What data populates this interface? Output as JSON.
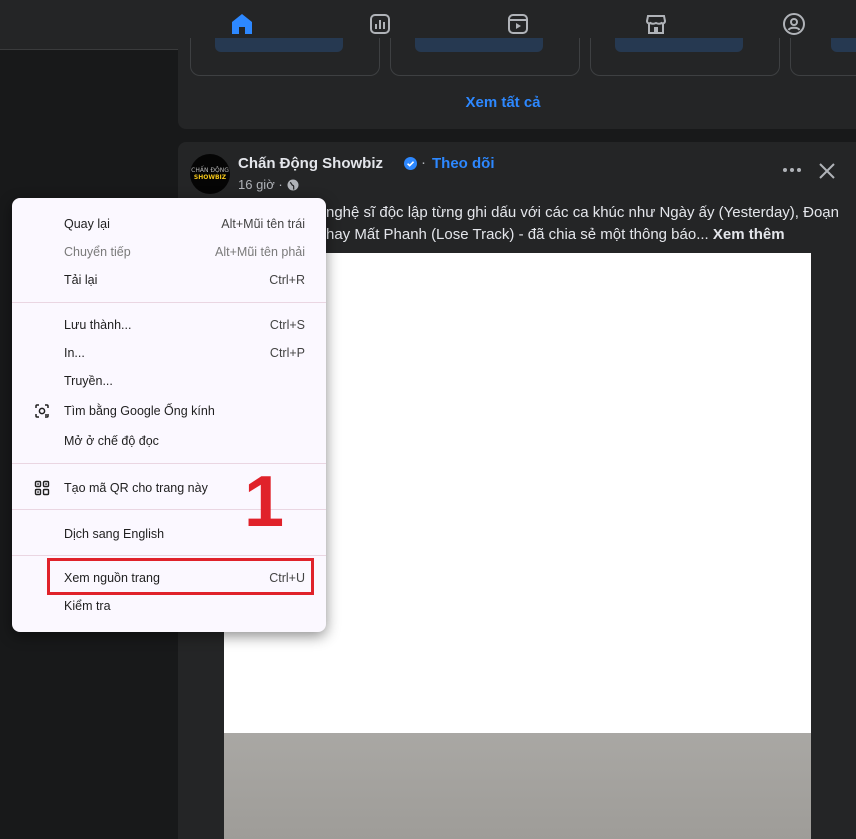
{
  "colors": {
    "accent": "#2d88ff",
    "page_bg": "#18191a",
    "card_bg": "#242526",
    "highlight_red": "#e0222a",
    "menu_bg": "#fbf8ff"
  },
  "topnav": {
    "items": [
      {
        "icon": "home-icon",
        "active": true
      },
      {
        "icon": "bar-chart-icon",
        "active": false
      },
      {
        "icon": "video-icon",
        "active": false
      },
      {
        "icon": "marketplace-icon",
        "active": false
      },
      {
        "icon": "groups-icon",
        "active": false
      }
    ]
  },
  "suggest": {
    "see_all": "Xem tất cả"
  },
  "post": {
    "page_name": "Chấn Động Showbiz",
    "avatar_line1": "CHẤN ĐỘNG",
    "avatar_line2": "SHOWBIZ",
    "follow": "Theo dõi",
    "dot": "·",
    "time": "16 giờ ·",
    "caption_line1": "nghệ sĩ độc lập từng ghi dấu với các ca khúc như Ngày ấy (Yesterday), Đoạn",
    "caption_line2": "hay Mất Phanh (Lose Track) - đã chia sẻ một thông báo...",
    "see_more": "Xem thêm"
  },
  "context_menu": {
    "items": [
      {
        "label": "Quay lại",
        "shortcut": "Alt+Mũi tên trái"
      },
      {
        "label": "Chuyển tiếp",
        "shortcut": "Alt+Mũi tên phải"
      },
      {
        "label": "Tải lại",
        "shortcut": "Ctrl+R"
      },
      {
        "label": "Lưu thành...",
        "shortcut": "Ctrl+S"
      },
      {
        "label": "In...",
        "shortcut": "Ctrl+P"
      },
      {
        "label": "Truyền..."
      },
      {
        "label": "Tìm bằng Google Ống kính"
      },
      {
        "label": "Mở ở chế độ đọc"
      },
      {
        "label": "Tạo mã QR cho trang này"
      },
      {
        "label": "Dịch sang English"
      },
      {
        "label": "Xem nguồn trang",
        "shortcut": "Ctrl+U"
      },
      {
        "label": "Kiểm tra"
      }
    ]
  },
  "annotation": {
    "step": "1"
  }
}
